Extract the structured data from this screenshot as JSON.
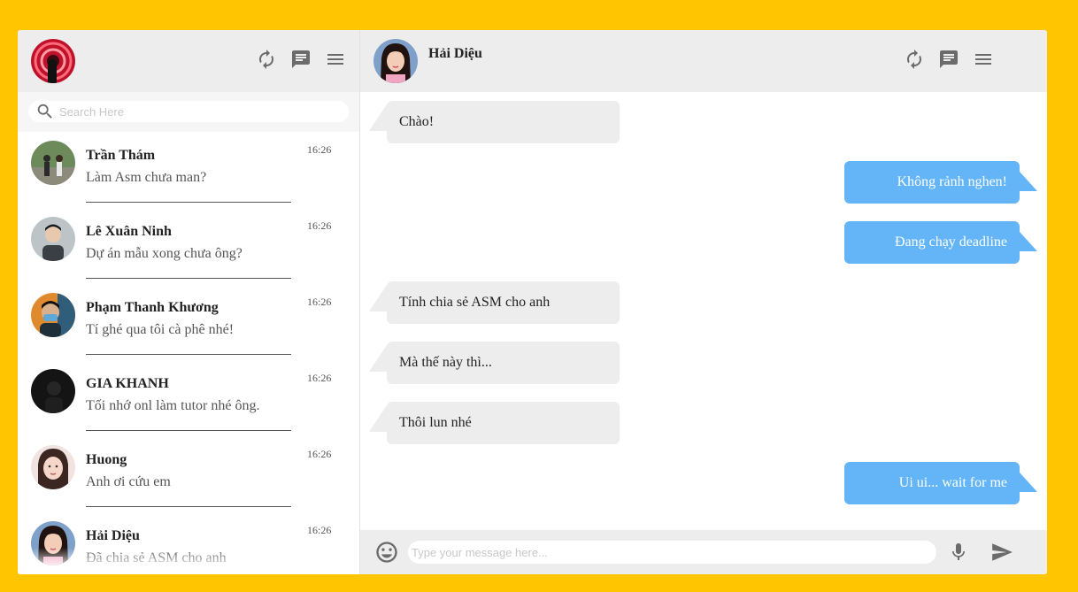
{
  "colors": {
    "background": "#FFC501",
    "panel_header": "#EDEDED",
    "incoming_bubble": "#EDEDED",
    "outgoing_bubble": "#63B5F8",
    "icon": "#6B6B6B"
  },
  "sidebar": {
    "header_icons": [
      "refresh-icon",
      "chat-icon",
      "menu-icon"
    ],
    "search": {
      "placeholder": "Search Here",
      "value": ""
    },
    "contacts": [
      {
        "name": "Trần Thám",
        "preview": "Làm Asm chưa man?",
        "time": "16:26"
      },
      {
        "name": "Lê Xuân Ninh",
        "preview": "Dự án mẫu xong chưa ông?",
        "time": "16:26"
      },
      {
        "name": "Phạm Thanh Khương",
        "preview": "Tí ghé qua tôi cà phê nhé!",
        "time": "16:26"
      },
      {
        "name": "GIA KHANH",
        "preview": "Tối nhớ onl làm tutor nhé ông.",
        "time": "16:26"
      },
      {
        "name": "Huong",
        "preview": "Anh ơi cứu em",
        "time": "16:26"
      },
      {
        "name": "Hải Diệu",
        "preview": "Đã chia sẻ ASM cho anh",
        "time": "16:26"
      }
    ]
  },
  "chat": {
    "contact_name": "Hải Diệu",
    "header_icons": [
      "refresh-icon",
      "chat-icon",
      "menu-icon"
    ],
    "messages": [
      {
        "direction": "in",
        "text": "Chào!"
      },
      {
        "direction": "out",
        "text": "Không rảnh nghen!"
      },
      {
        "direction": "out",
        "text": "Đang chạy deadline"
      },
      {
        "direction": "in",
        "text": "Tính chia sẻ ASM cho anh"
      },
      {
        "direction": "in",
        "text": "Mà thế này thì..."
      },
      {
        "direction": "in",
        "text": "Thôi lun nhé"
      },
      {
        "direction": "out",
        "text": "Ui ui... wait for me"
      }
    ],
    "composer": {
      "placeholder": "Type your message here...",
      "value": ""
    }
  }
}
